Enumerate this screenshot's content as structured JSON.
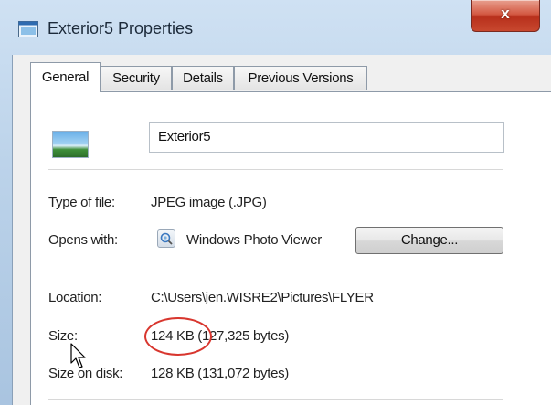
{
  "window": {
    "title": "Exterior5 Properties",
    "close_label": "x"
  },
  "tabs": [
    {
      "label": "General",
      "active": true
    },
    {
      "label": "Security",
      "active": false
    },
    {
      "label": "Details",
      "active": false
    },
    {
      "label": "Previous Versions",
      "active": false
    }
  ],
  "general": {
    "file_name": "Exterior5",
    "type_label": "Type of file:",
    "type_value": "JPEG image (.JPG)",
    "opens_label": "Opens with:",
    "opens_value": "Windows Photo Viewer",
    "change_label": "Change...",
    "location_label": "Location:",
    "location_value": "C:\\Users\\jen.WISRE2\\Pictures\\FLYER",
    "size_label": "Size:",
    "size_value_highlight": "124 KB",
    "size_value_rest": "(127,325 bytes)",
    "size_on_disk_label": "Size on disk:",
    "size_on_disk_value": "128 KB (131,072 bytes)"
  },
  "annotation": {
    "color": "#d8362e"
  },
  "icons": {
    "app": "properties-window-icon",
    "thumbnail": "jpeg-thumbnail-icon",
    "viewer": "photo-viewer-icon",
    "cursor": "mouse-pointer-icon"
  }
}
